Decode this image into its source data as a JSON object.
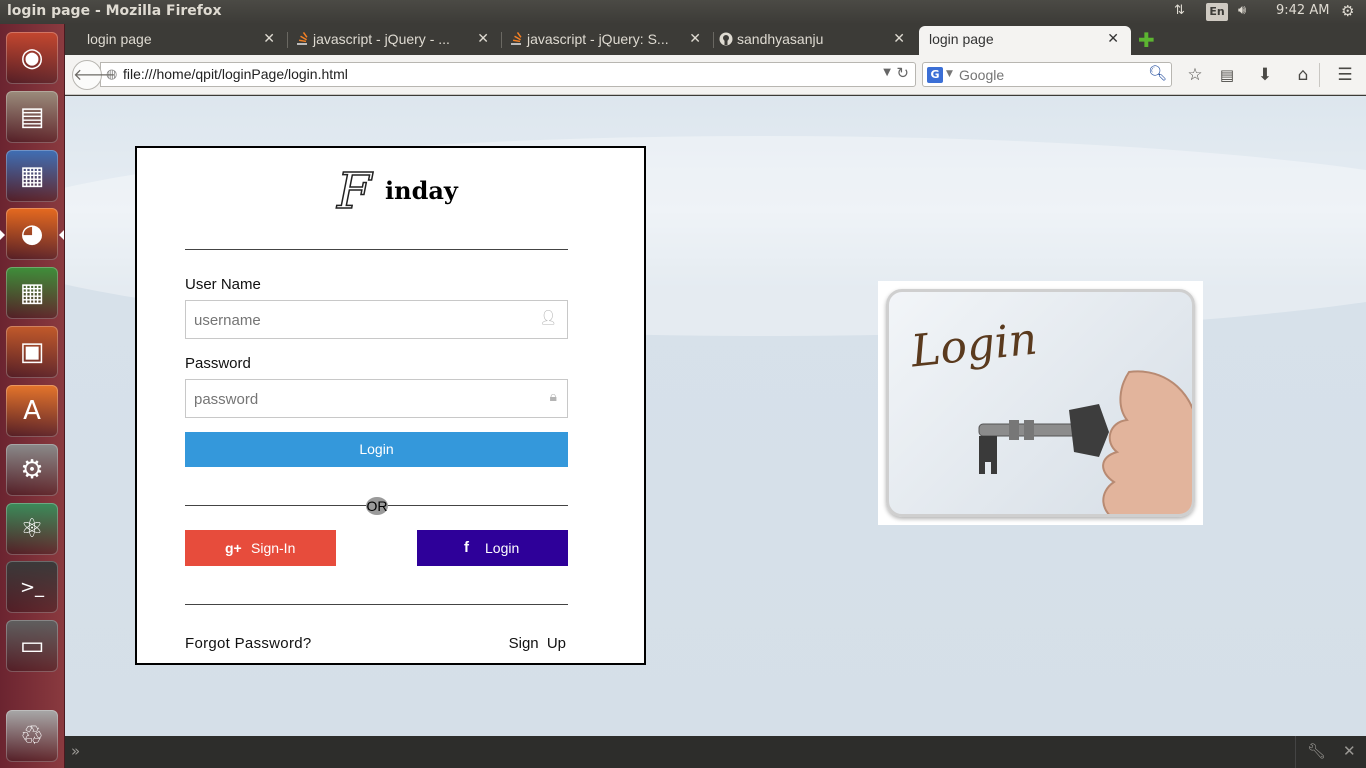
{
  "window": {
    "title": "login page - Mozilla Firefox"
  },
  "system_tray": {
    "network_icon": "network-transfer-icon",
    "keyboard_layout": "En",
    "volume_icon": "speaker-icon",
    "time": "9:42 AM",
    "settings_icon": "gear-icon"
  },
  "launcher": {
    "items": [
      {
        "name": "ubuntu-dash-icon",
        "glyph": "◉",
        "color": "#c4472f"
      },
      {
        "name": "files-icon",
        "glyph": "▤",
        "color": "#9b8c7c"
      },
      {
        "name": "libreoffice-writer-icon",
        "glyph": "▦",
        "color": "#3f6fb5"
      },
      {
        "name": "firefox-icon",
        "glyph": "◕",
        "color": "#e66a1f"
      },
      {
        "name": "libreoffice-calc-icon",
        "glyph": "▦",
        "color": "#3e8f3a"
      },
      {
        "name": "libreoffice-impress-icon",
        "glyph": "▣",
        "color": "#c25a2a"
      },
      {
        "name": "software-center-icon",
        "glyph": "A",
        "color": "#e5752b"
      },
      {
        "name": "system-settings-icon",
        "glyph": "⚙",
        "color": "#8a8a8a"
      },
      {
        "name": "atom-editor-icon",
        "glyph": "⚛",
        "color": "#3b8c5a"
      },
      {
        "name": "terminal-icon",
        "glyph": ">_",
        "color": "#3a3a3a"
      },
      {
        "name": "save-disk-icon",
        "glyph": "▭",
        "color": "#5f5f5f"
      },
      {
        "name": "trash-icon",
        "glyph": "♲",
        "color": "#a8a8a8"
      }
    ]
  },
  "tabs": [
    {
      "label": "login page",
      "active": false,
      "favicon": "none"
    },
    {
      "label": "javascript - jQuery - ...",
      "active": false,
      "favicon": "stackoverflow-icon"
    },
    {
      "label": "javascript - jQuery: S...",
      "active": false,
      "favicon": "stackoverflow-icon"
    },
    {
      "label": "sandhyasanju",
      "active": false,
      "favicon": "github-icon"
    },
    {
      "label": "login page",
      "active": true,
      "favicon": "none"
    }
  ],
  "navbar": {
    "url": "file:///home/qpit/loginPage/login.html",
    "search_placeholder": "Google",
    "search_engine": "G"
  },
  "login_form": {
    "brand_initial": "F",
    "brand_rest": "inday",
    "username_label": "User Name",
    "username_placeholder": "username",
    "password_label": "Password",
    "password_placeholder": "password",
    "login_button": "Login",
    "divider_text": "OR",
    "google_button": "Sign-In",
    "google_icon": "g+",
    "facebook_button": "Login",
    "facebook_icon": "f",
    "forgot_password": "Forgot Password?",
    "sign_up": "Sign Up"
  },
  "side_image": {
    "caption": "Login"
  },
  "colors": {
    "login_button": "#3498db",
    "google_button": "#e74c3c",
    "facebook_button": "#2e0099"
  }
}
